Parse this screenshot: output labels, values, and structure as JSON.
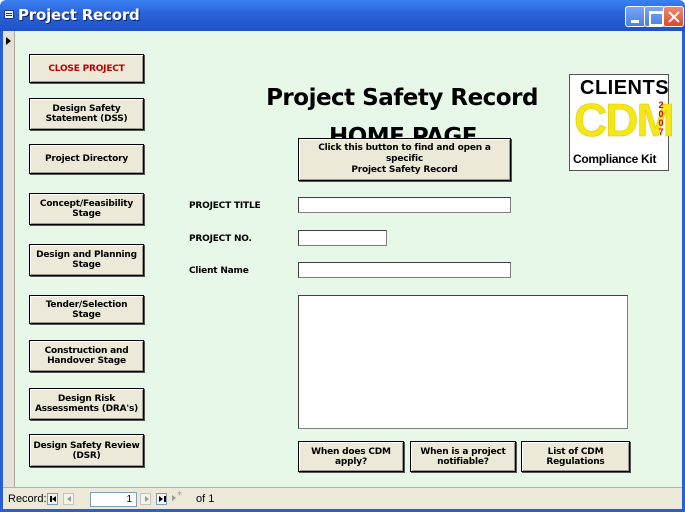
{
  "window": {
    "title": "Project Record"
  },
  "sidebar": {
    "buttons": [
      {
        "label": "CLOSE PROJECT"
      },
      {
        "label": "Design Safety\nStatement (DSS)"
      },
      {
        "label": "Project Directory"
      },
      {
        "label": "Concept/Feasibility\nStage"
      },
      {
        "label": "Design and Planning\nStage"
      },
      {
        "label": "Tender/Selection Stage"
      },
      {
        "label": "Construction and\nHandover Stage"
      },
      {
        "label": "Design Risk\nAssessments (DRA's)"
      },
      {
        "label": "Design Safety Review\n(DSR)"
      }
    ]
  },
  "header": {
    "title": "Project Safety Record",
    "subtitle": "HOME PAGE"
  },
  "logo": {
    "top_text": "CLIENTS",
    "main_text": "CDM",
    "year": "2\n0\n0\n7",
    "bottom_text": "Compliance Kit"
  },
  "form": {
    "find_button_label": "Click this button to find and open a specific\nProject Safety Record",
    "project_title_label": "PROJECT TITLE",
    "project_title_value": "",
    "project_no_label": "PROJECT NO.",
    "project_no_value": "",
    "client_name_label": "Client Name",
    "client_name_value": "",
    "notes_value": ""
  },
  "bottom_buttons": {
    "when_cdm_apply": "When does CDM apply?",
    "when_notifiable": "When is a project\nnotifiable?",
    "list_regulations": "List of CDM Regulations"
  },
  "navigation": {
    "record_label": "Record:",
    "current": "1",
    "total_text": "of 1"
  },
  "colors": {
    "form_background": "#e8f8e8",
    "close_project_text": "#c00000",
    "title_bar": "#2a62d8",
    "logo_cdm": "#f5e617",
    "logo_year": "#d40000"
  }
}
